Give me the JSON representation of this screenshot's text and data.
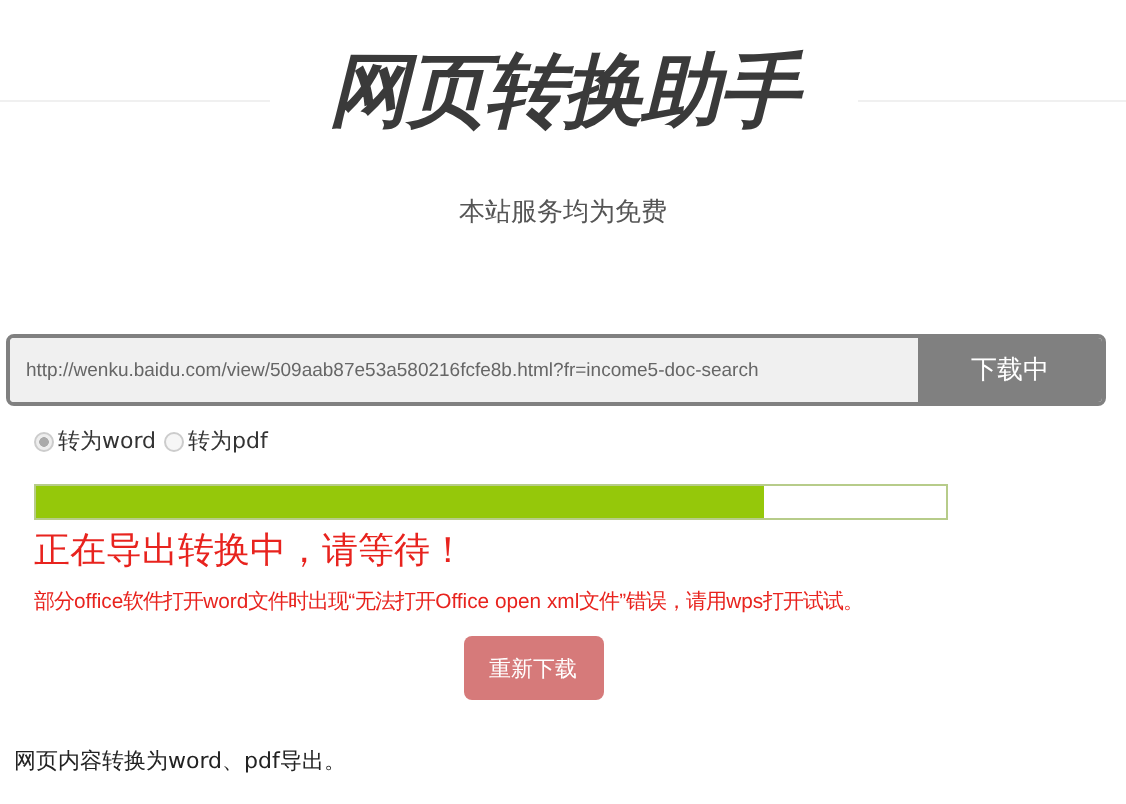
{
  "header": {
    "title": "网页转换助手",
    "subtitle": "本站服务均为免费"
  },
  "url_form": {
    "value": "http://wenku.baidu.com/view/509aab87e53a580216fcfe8b.html?fr=income5-doc-search",
    "button": "下载中"
  },
  "formats": [
    {
      "label": "转为word",
      "selected": true
    },
    {
      "label": "转为pdf",
      "selected": false
    }
  ],
  "progress": {
    "level": 0.8,
    "status": "正在导出转换中，请等待！",
    "note": "部分office软件打开word文件时出现“无法打开Office open xml文件”错误，请用wps打开试试。"
  },
  "retry_button": "重新下载",
  "footer": "网页内容转换为word、pdf导出。"
}
